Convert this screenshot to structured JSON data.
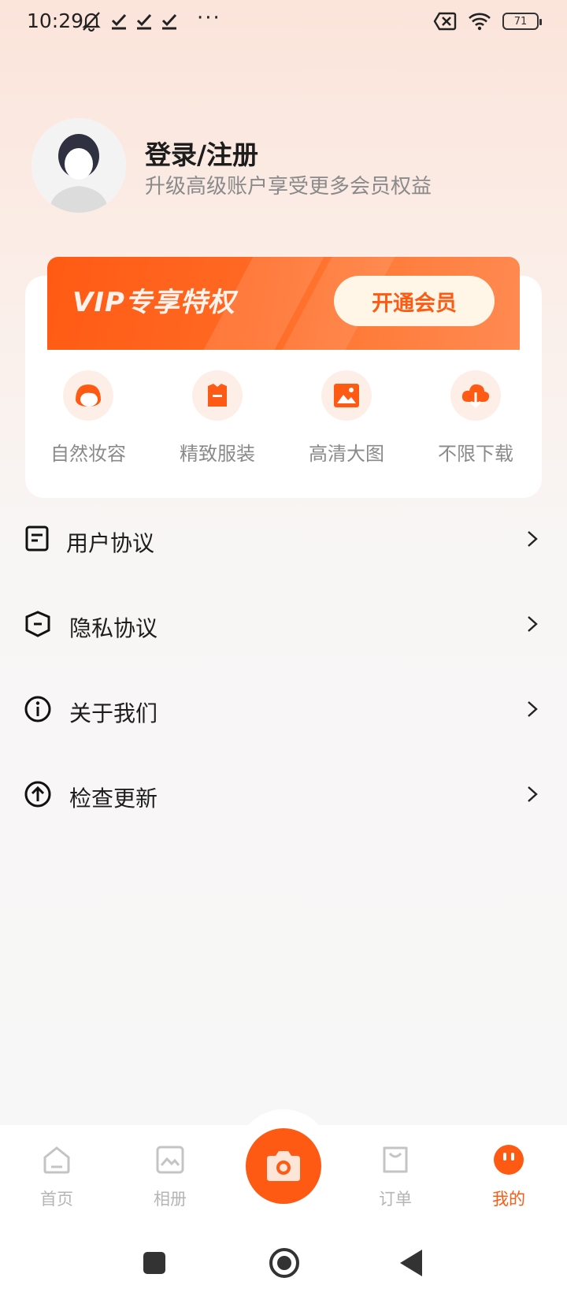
{
  "status_bar": {
    "time": "10:29",
    "more_indicator": "···",
    "battery_level": "71",
    "icons": [
      "mute-bell-icon",
      "check-icon",
      "check-icon",
      "check-icon",
      "sim-off-icon",
      "wifi-icon",
      "battery-icon"
    ]
  },
  "profile": {
    "title": "登录/注册",
    "subtitle": "升级高级账户享受更多会员权益",
    "avatar_icon": "default-avatar-icon"
  },
  "vip": {
    "title": "VIP专享特权",
    "button_label": "开通会员",
    "perks": [
      {
        "label": "自然妆容",
        "icon": "makeup-face-icon"
      },
      {
        "label": "精致服装",
        "icon": "clothing-icon"
      },
      {
        "label": "高清大图",
        "icon": "hd-image-icon"
      },
      {
        "label": "不限下载",
        "icon": "cloud-download-icon"
      }
    ]
  },
  "menu": [
    {
      "label": "用户协议",
      "icon": "document-icon"
    },
    {
      "label": "隐私协议",
      "icon": "shield-icon"
    },
    {
      "label": "关于我们",
      "icon": "info-icon"
    },
    {
      "label": "检查更新",
      "icon": "upload-arrow-icon"
    }
  ],
  "bottom_nav": {
    "items": [
      {
        "label": "首页",
        "icon": "home-icon"
      },
      {
        "label": "相册",
        "icon": "album-icon"
      },
      {
        "label": "订单",
        "icon": "shopping-bag-icon"
      },
      {
        "label": "我的",
        "icon": "profile-face-icon"
      }
    ],
    "active": "我的",
    "center_icon": "camera-icon"
  },
  "colors": {
    "accent": "#ff5a14",
    "accent_light": "#fdeee8",
    "text_primary": "#1d1d1d",
    "text_secondary": "#8a8a8a",
    "nav_inactive": "#b5b5b5"
  }
}
